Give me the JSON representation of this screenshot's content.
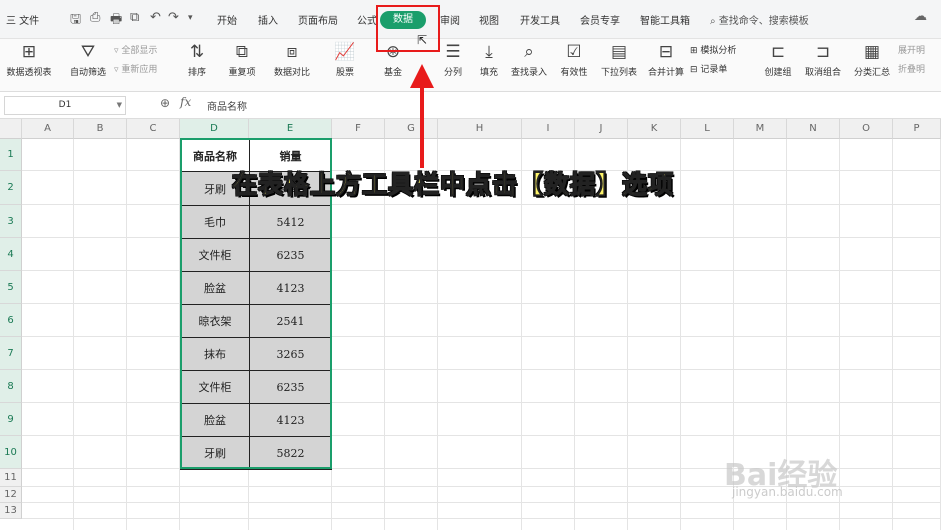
{
  "menubar": {
    "file": "三 文件",
    "tabs": [
      "开始",
      "插入",
      "页面布局",
      "公式",
      "数据",
      "审阅",
      "视图",
      "开发工具",
      "会员专享",
      "智能工具箱"
    ],
    "active_tab": "数据",
    "search": "查找命令、搜索模板",
    "active_color": "#1a9e6b"
  },
  "ribbon": {
    "pivot": "数据透视表",
    "autofilter": "自动筛选",
    "show_all": "全部显示",
    "reapply": "重新应用",
    "sort": "排序",
    "dup": "重复项",
    "compare": "数据对比",
    "stock": "股票",
    "fund": "基金",
    "split": "分列",
    "fill": "填充",
    "lookup": "查找录入",
    "valid": "有效性",
    "dropdown": "下拉列表",
    "consolidate": "合并计算",
    "simulate": "模拟分析",
    "record": "记录单",
    "group": "创建组",
    "ungroup": "取消组合",
    "subtotal": "分类汇总",
    "expand": "展开明",
    "collapse": "折叠明"
  },
  "formula_bar": {
    "cell_ref": "D1",
    "fx": "fx",
    "content": "商品名称"
  },
  "sheet": {
    "columns": [
      "A",
      "B",
      "C",
      "D",
      "E",
      "F",
      "G",
      "H",
      "I",
      "J",
      "K",
      "L",
      "M",
      "N",
      "O",
      "P"
    ],
    "rows": [
      "1",
      "2",
      "3",
      "4",
      "5",
      "6",
      "7",
      "8",
      "9",
      "10",
      "11",
      "12",
      "13"
    ],
    "header": [
      "商品名称",
      "销量"
    ],
    "data": [
      [
        "牙刷",
        "5822"
      ],
      [
        "毛巾",
        "5412"
      ],
      [
        "文件柜",
        "6235"
      ],
      [
        "脸盆",
        "4123"
      ],
      [
        "晾衣架",
        "2541"
      ],
      [
        "抹布",
        "3265"
      ],
      [
        "文件柜",
        "6235"
      ],
      [
        "脸盆",
        "4123"
      ],
      [
        "牙刷",
        "5822"
      ]
    ],
    "selection_color": "#1a9e6b"
  },
  "annotation": {
    "text": "在表格上方工具栏中点击【数据】选项",
    "color": "#e81b1b"
  },
  "watermark": {
    "brand": "Bai经验",
    "url": "jingyan.baidu.com"
  }
}
